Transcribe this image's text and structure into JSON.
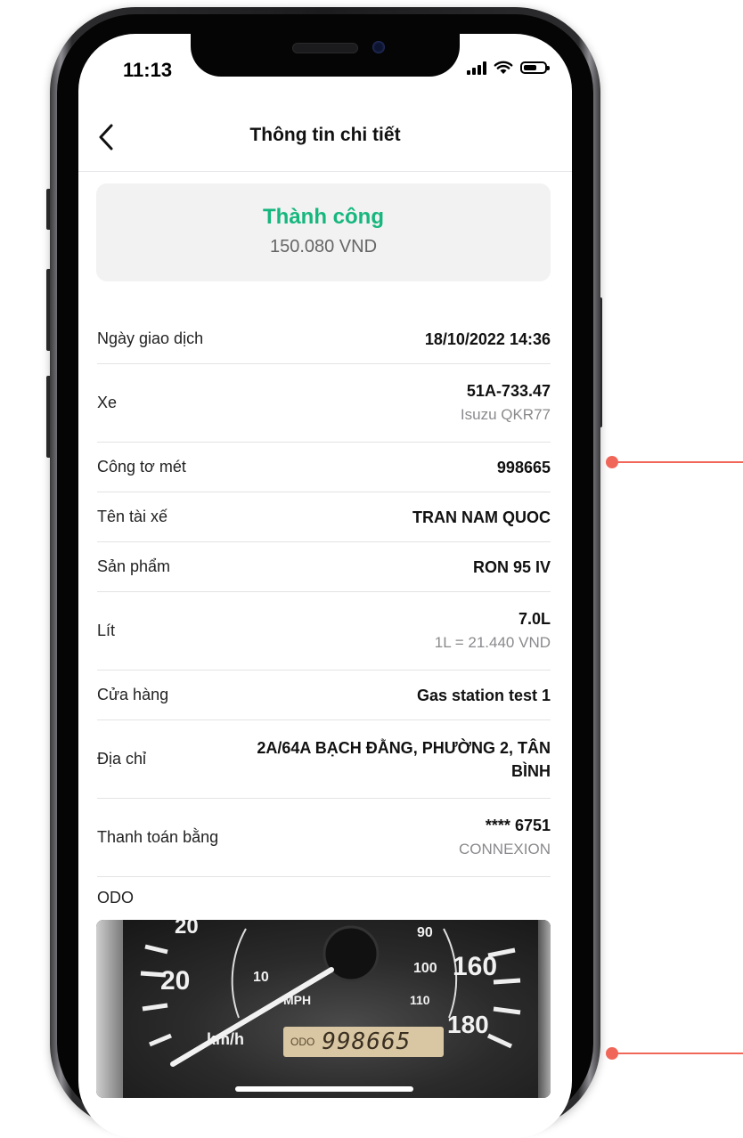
{
  "status_bar": {
    "time": "11:13"
  },
  "header": {
    "title": "Thông tin chi tiết"
  },
  "transaction": {
    "status": "Thành công",
    "amount": "150.080  VND"
  },
  "details": {
    "date": {
      "label": "Ngày giao dịch",
      "value": "18/10/2022 14:36"
    },
    "vehicle": {
      "label": "Xe",
      "plate": "51A-733.47",
      "model": "Isuzu QKR77"
    },
    "odometer": {
      "label": "Công tơ mét",
      "value": "998665"
    },
    "driver": {
      "label": "Tên tài xế",
      "value": "TRAN NAM QUOC"
    },
    "product": {
      "label": "Sản phẩm",
      "value": "RON 95 IV"
    },
    "liters": {
      "label": "Lít",
      "value": "7.0L",
      "unit_price": "1L = 21.440  VND"
    },
    "store": {
      "label": "Cửa hàng",
      "value": "Gas station test 1"
    },
    "address": {
      "label": "Địa chỉ",
      "line1": "2A/64A BẠCH ĐẰNG, PHƯỜNG 2, TÂN",
      "line2": "BÌNH"
    },
    "payment": {
      "label": "Thanh toán bằng",
      "card": "**** 6751",
      "provider": "CONNEXION"
    }
  },
  "odo_section": {
    "label": "ODO",
    "photo": {
      "gauge_numbers": [
        "20",
        "20",
        "10",
        "MPH",
        "90",
        "100",
        "160",
        "110",
        "180",
        "km/h"
      ],
      "readout_label": "ODO",
      "readout_digits": "998665"
    }
  },
  "colors": {
    "success": "#16b77e",
    "callout": "#f0675a"
  }
}
